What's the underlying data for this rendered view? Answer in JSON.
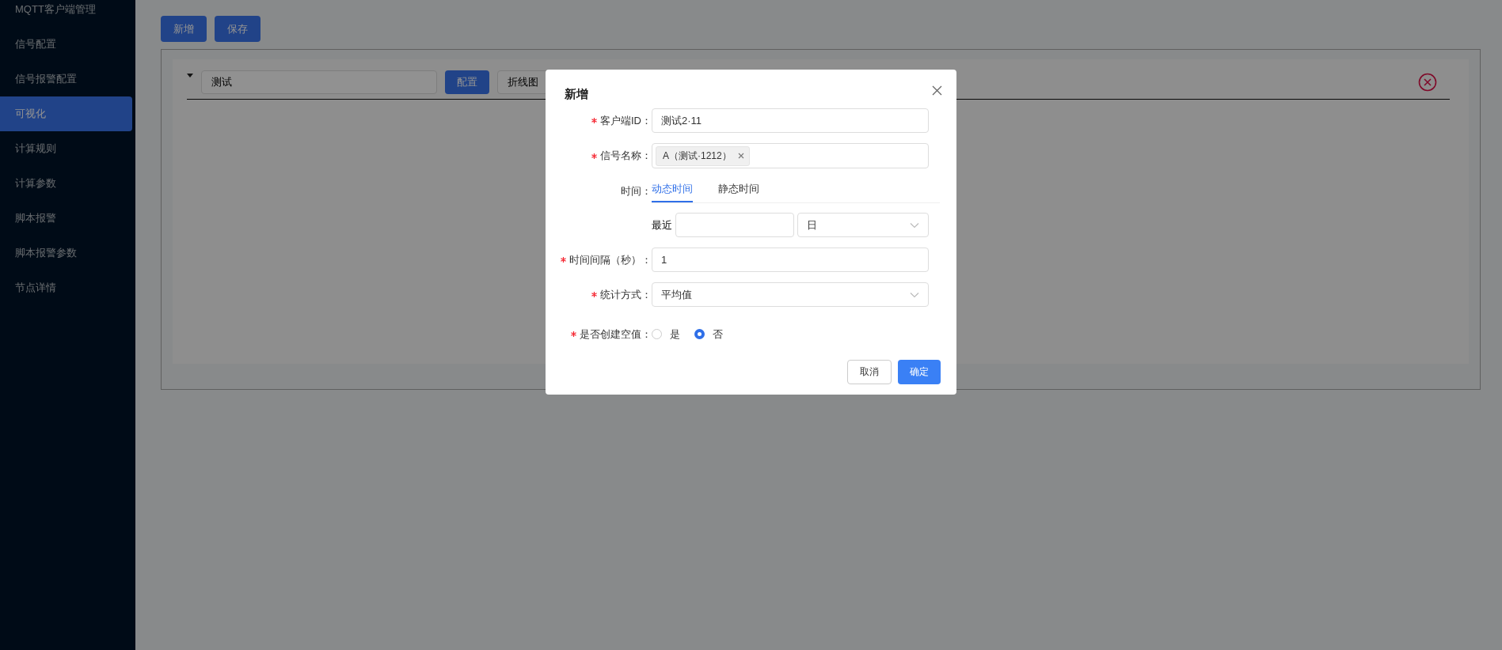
{
  "sidebar": {
    "items": [
      {
        "label": "MQTT客户端管理",
        "selected": false
      },
      {
        "label": "信号配置",
        "selected": false
      },
      {
        "label": "信号报警配置",
        "selected": false
      },
      {
        "label": "可视化",
        "selected": true
      },
      {
        "label": "计算规则",
        "selected": false
      },
      {
        "label": "计算参数",
        "selected": false
      },
      {
        "label": "脚本报警",
        "selected": false
      },
      {
        "label": "脚本报警参数",
        "selected": false
      },
      {
        "label": "节点详情",
        "selected": false
      }
    ]
  },
  "toolbar": {
    "buttons": [
      "新增",
      "保存"
    ]
  },
  "panel": {
    "name": "测试",
    "config_button": "配置",
    "chart_type": "折线图"
  },
  "dialog": {
    "title": "新增",
    "fields": [
      {
        "kind": "input",
        "label": "客户端ID：",
        "required": true,
        "value": "测试2·11"
      },
      {
        "kind": "tags",
        "label": "信号名称：",
        "required": true,
        "tags": [
          "A（测试·1212）"
        ]
      },
      {
        "kind": "tabs",
        "label": "时间：",
        "required": false,
        "tabs": [
          {
            "label": "动态时间",
            "selected": true
          },
          {
            "label": "静态时间",
            "selected": false
          }
        ]
      },
      {
        "kind": "recent",
        "label": "最近",
        "unit": "日"
      },
      {
        "kind": "input",
        "label": "时间间隔（秒）：",
        "required": true,
        "value": "1"
      },
      {
        "kind": "select",
        "label": "统计方式：",
        "required": true,
        "value": "平均值"
      },
      {
        "kind": "radio",
        "label": "是否创建空值：",
        "required": true,
        "options": [
          {
            "label": "是",
            "selected": false
          },
          {
            "label": "否",
            "selected": true
          }
        ]
      }
    ],
    "buttons": [
      {
        "label": "取消",
        "kind": "default"
      },
      {
        "label": "确定",
        "kind": "primary"
      }
    ]
  }
}
